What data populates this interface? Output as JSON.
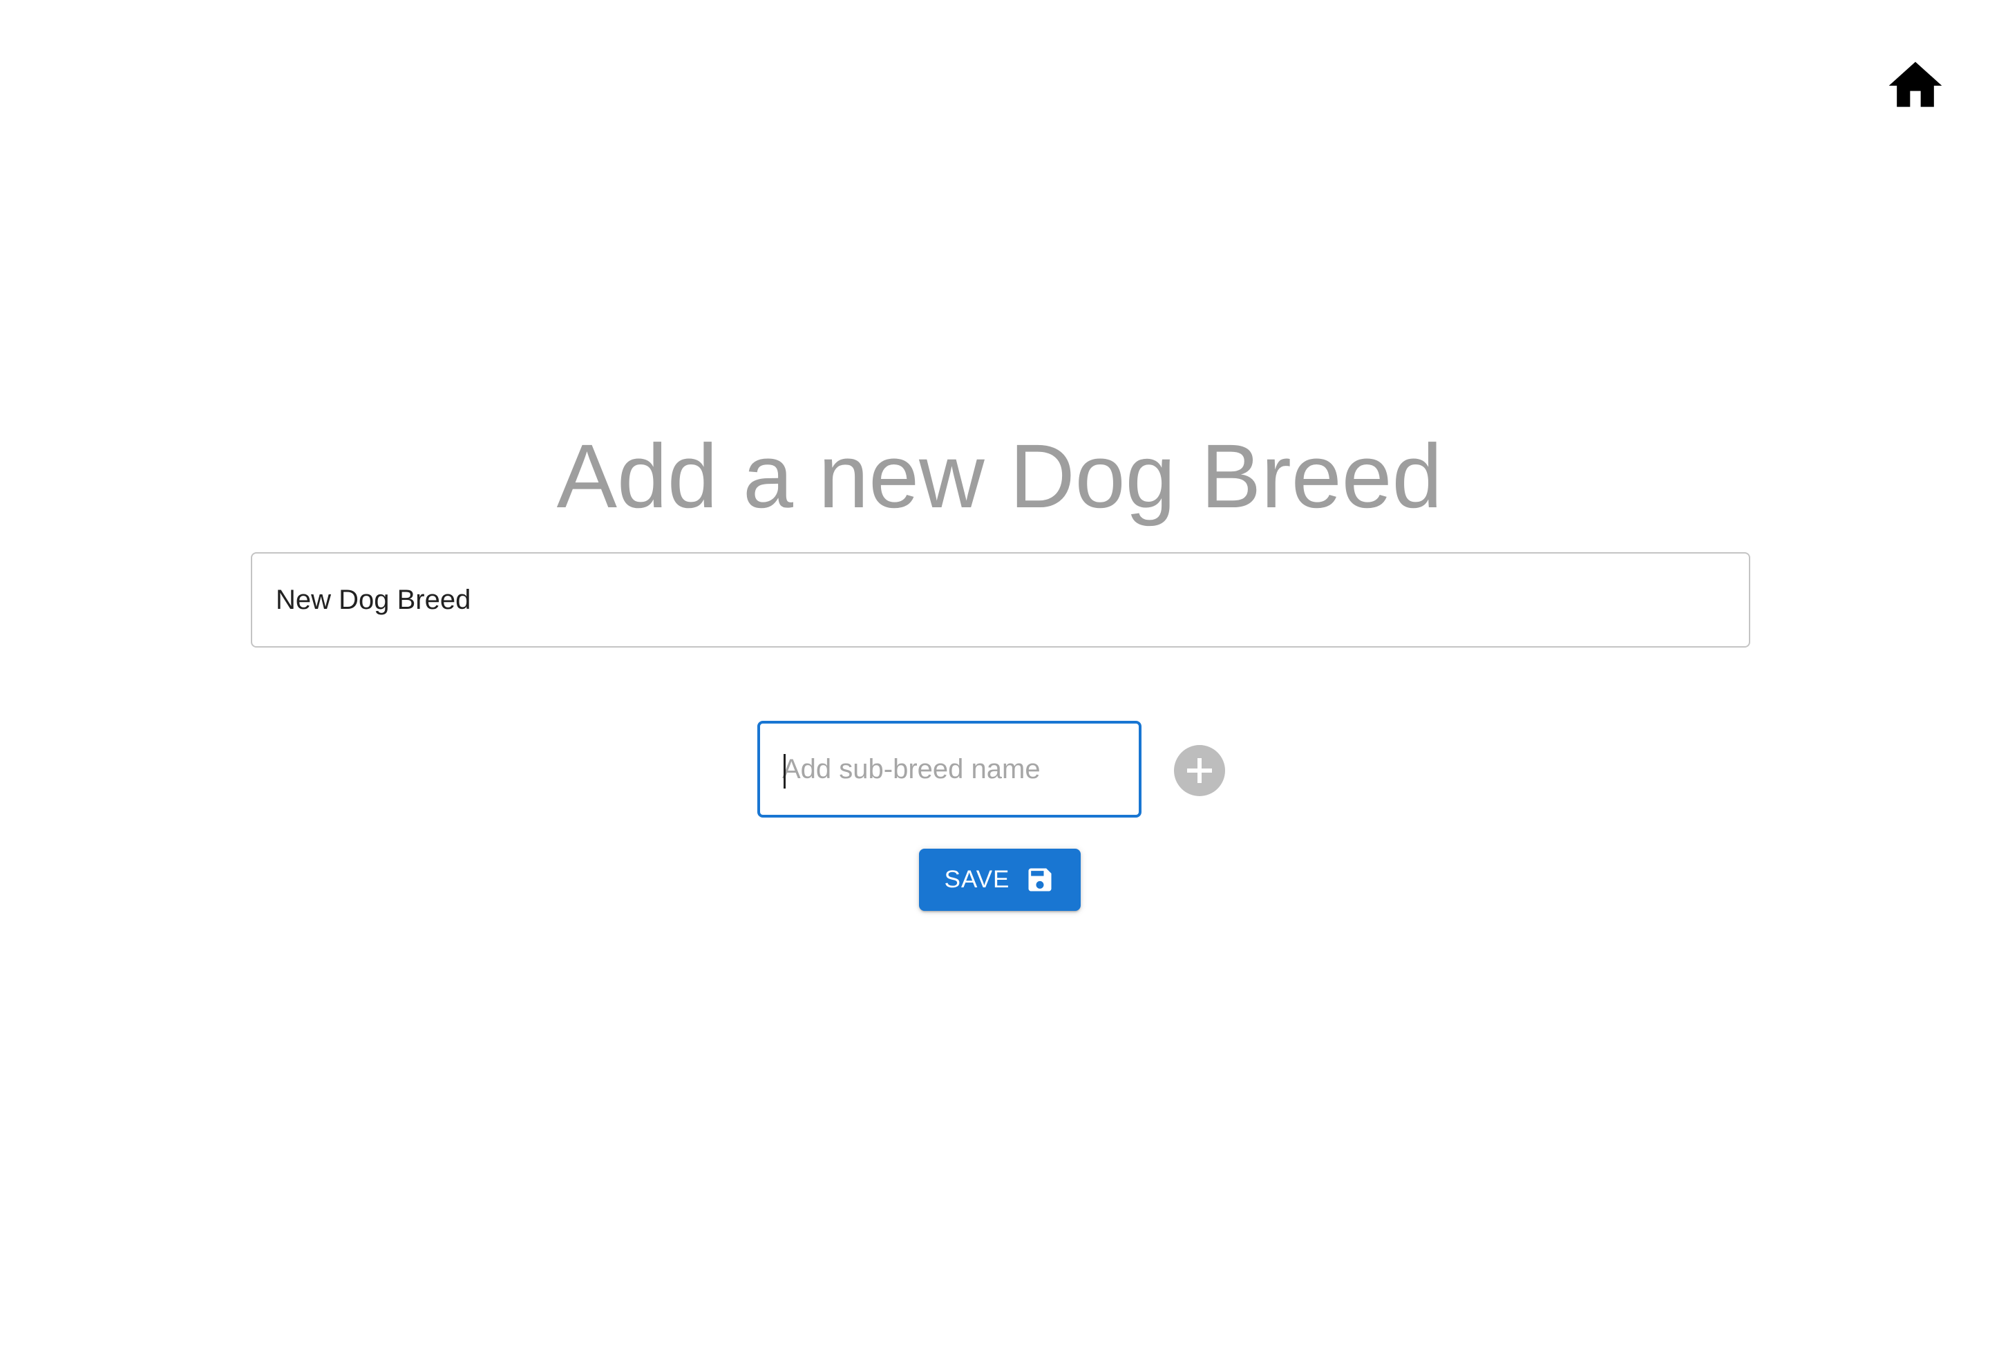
{
  "nav": {
    "home_icon": "home-icon"
  },
  "page": {
    "title": "Add a new Dog Breed"
  },
  "form": {
    "breed_name_value": "New Dog Breed",
    "sub_breed_placeholder": "Add sub-breed name",
    "sub_breed_value": "",
    "add_icon": "plus-circle-icon",
    "save_label": "SAVE",
    "save_icon": "floppy-disk-icon"
  },
  "colors": {
    "primary": "#1976d2",
    "title_gray": "#9e9e9e",
    "add_button_gray": "#bdbdbd",
    "border_gray": "#c4c4c4"
  }
}
